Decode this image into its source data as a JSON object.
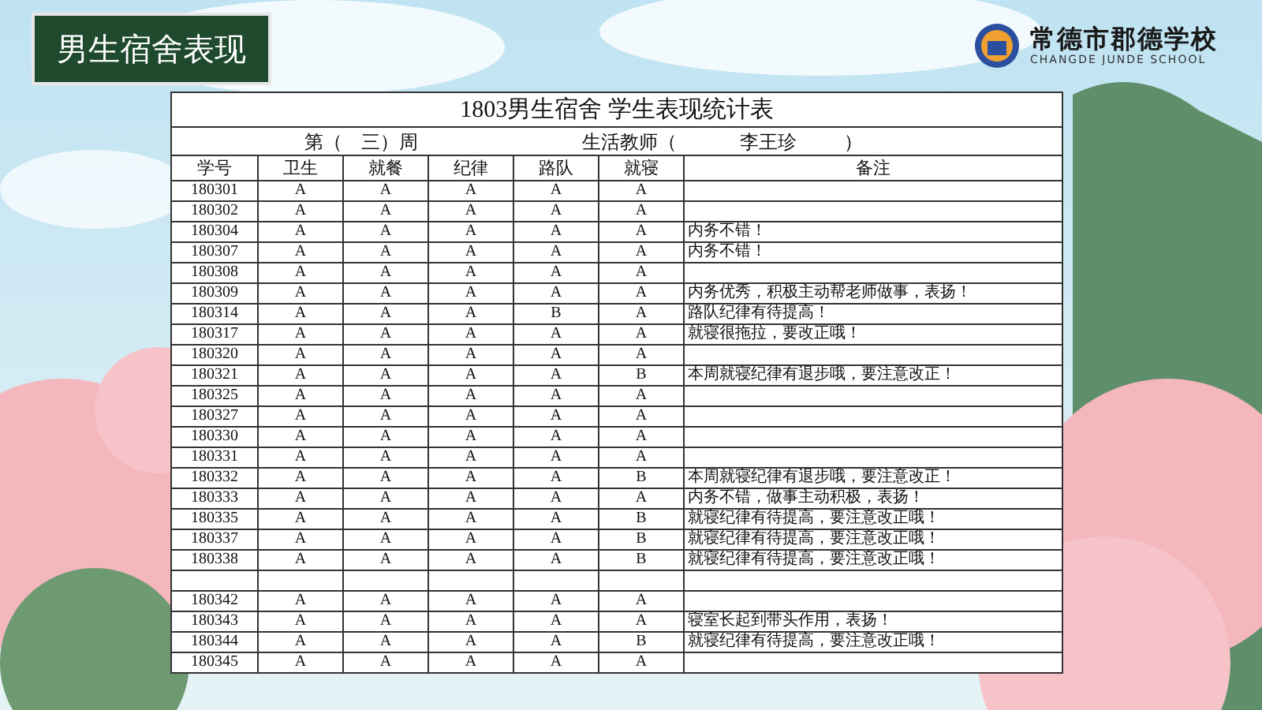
{
  "badge": {
    "title": "男生宿舍表现"
  },
  "logo": {
    "name": "常德市郡德学校",
    "subtitle": "CHANGDE JUNDE SCHOOL"
  },
  "sheet": {
    "title": "1803男生宿舍  学生表现统计表",
    "week_label": "第（　三）周",
    "teacher_label": "生活教师（",
    "teacher_name": "李王珍",
    "teacher_close": "）",
    "columns": [
      "学号",
      "卫生",
      "就餐",
      "纪律",
      "路队",
      "就寝",
      "备注"
    ],
    "rows": [
      {
        "kind": "student",
        "id": "180301",
        "grades": [
          "A",
          "A",
          "A",
          "A",
          "A"
        ]
      },
      {
        "kind": "student",
        "id": "180302",
        "grades": [
          "A",
          "A",
          "A",
          "A",
          "A"
        ]
      },
      {
        "kind": "student",
        "id": "180304",
        "grades": [
          "A",
          "A",
          "A",
          "A",
          "A"
        ],
        "note": "内务不错！"
      },
      {
        "kind": "student",
        "id": "180307",
        "grades": [
          "A",
          "A",
          "A",
          "A",
          "A"
        ],
        "note": "内务不错！"
      },
      {
        "kind": "student",
        "id": "180308",
        "grades": [
          "A",
          "A",
          "A",
          "A",
          "A"
        ]
      },
      {
        "kind": "student",
        "id": "180309",
        "grades": [
          "A",
          "A",
          "A",
          "A",
          "A"
        ],
        "note": "内务优秀，积极主动帮老师做事，表扬！"
      },
      {
        "kind": "student",
        "id": "180314",
        "grades": [
          "A",
          "A",
          "A",
          "B",
          "A"
        ],
        "note": "路队纪律有待提高！"
      },
      {
        "kind": "student",
        "id": "180317",
        "grades": [
          "A",
          "A",
          "A",
          "A",
          "A"
        ],
        "note": "就寝很拖拉，要改正哦！"
      },
      {
        "kind": "student",
        "id": "180320",
        "grades": [
          "A",
          "A",
          "A",
          "A",
          "A"
        ]
      },
      {
        "kind": "student",
        "id": "180321",
        "grades": [
          "A",
          "A",
          "A",
          "A",
          "B"
        ],
        "note": "本周就寝纪律有退步哦，要注意改正！"
      },
      {
        "kind": "student",
        "id": "180325",
        "grades": [
          "A",
          "A",
          "A",
          "A",
          "A"
        ]
      },
      {
        "kind": "student",
        "id": "180327",
        "grades": [
          "A",
          "A",
          "A",
          "A",
          "A"
        ]
      },
      {
        "kind": "student",
        "id": "180330",
        "grades": [
          "A",
          "A",
          "A",
          "A",
          "A"
        ]
      },
      {
        "kind": "student",
        "id": "180331",
        "grades": [
          "A",
          "A",
          "A",
          "A",
          "A"
        ]
      },
      {
        "kind": "student",
        "id": "180332",
        "grades": [
          "A",
          "A",
          "A",
          "A",
          "B"
        ],
        "note": "本周就寝纪律有退步哦，要注意改正！"
      },
      {
        "kind": "student",
        "id": "180333",
        "grades": [
          "A",
          "A",
          "A",
          "A",
          "A"
        ],
        "note": "内务不错，做事主动积极，表扬！"
      },
      {
        "kind": "student",
        "id": "180335",
        "grades": [
          "A",
          "A",
          "A",
          "A",
          "B"
        ],
        "note": "就寝纪律有待提高，要注意改正哦！"
      },
      {
        "kind": "student",
        "id": "180337",
        "grades": [
          "A",
          "A",
          "A",
          "A",
          "B"
        ],
        "note": "就寝纪律有待提高，要注意改正哦！"
      },
      {
        "kind": "student",
        "id": "180338",
        "grades": [
          "A",
          "A",
          "A",
          "A",
          "B"
        ],
        "note": "就寝纪律有待提高，要注意改正哦！"
      },
      {
        "kind": "blank"
      },
      {
        "kind": "student",
        "id": "180342",
        "grades": [
          "A",
          "A",
          "A",
          "A",
          "A"
        ]
      },
      {
        "kind": "student",
        "id": "180343",
        "grades": [
          "A",
          "A",
          "A",
          "A",
          "A"
        ],
        "note": "寝室长起到带头作用，表扬！"
      },
      {
        "kind": "student",
        "id": "180344",
        "grades": [
          "A",
          "A",
          "A",
          "A",
          "B"
        ],
        "note": "就寝纪律有待提高，要注意改正哦！"
      },
      {
        "kind": "student",
        "id": "180345",
        "grades": [
          "A",
          "A",
          "A",
          "A",
          "A"
        ]
      }
    ]
  }
}
